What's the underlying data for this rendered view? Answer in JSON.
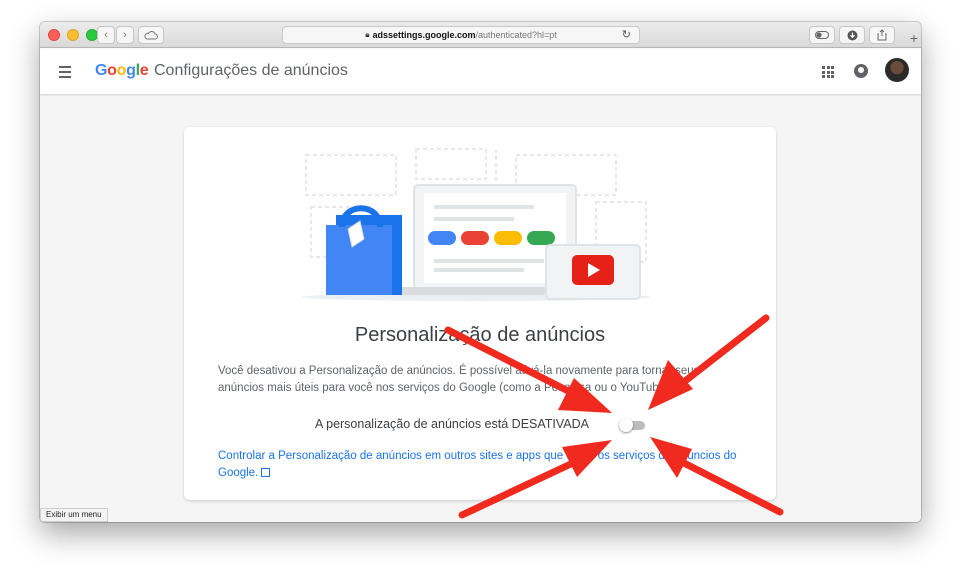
{
  "browser": {
    "url_host": "adssettings.google.com",
    "url_path": "/authenticated?hl=pt",
    "status_tooltip": "Exibir um menu"
  },
  "header": {
    "logo_letters": [
      {
        "char": "G",
        "color": "#4285f4"
      },
      {
        "char": "o",
        "color": "#ea4335"
      },
      {
        "char": "o",
        "color": "#fbbc05"
      },
      {
        "char": "g",
        "color": "#4285f4"
      },
      {
        "char": "l",
        "color": "#34a853"
      },
      {
        "char": "e",
        "color": "#ea4335"
      }
    ],
    "title": "Configurações de anúncios",
    "icons": [
      "menu-icon",
      "apps-icon",
      "notifications-icon",
      "avatar"
    ]
  },
  "card": {
    "title": "Personalização de anúncios",
    "description": "Você desativou a Personalização de anúncios. É possível ativá-la novamente para tornar seus anúncios mais úteis para você nos serviços do Google (como a Pesquisa ou o YouTube).",
    "status_label": "A personalização de anúncios está DESATIVADA",
    "toggle_on": false,
    "link_text": "Controlar a Personalização de anúncios em outros sites e apps que usam os serviços de anúncios do Google."
  },
  "colors": {
    "google_blue": "#4285f4",
    "google_red": "#ea4335",
    "google_yellow": "#fbbc05",
    "google_green": "#34a853",
    "annotation_arrow": "#f02a1e"
  }
}
